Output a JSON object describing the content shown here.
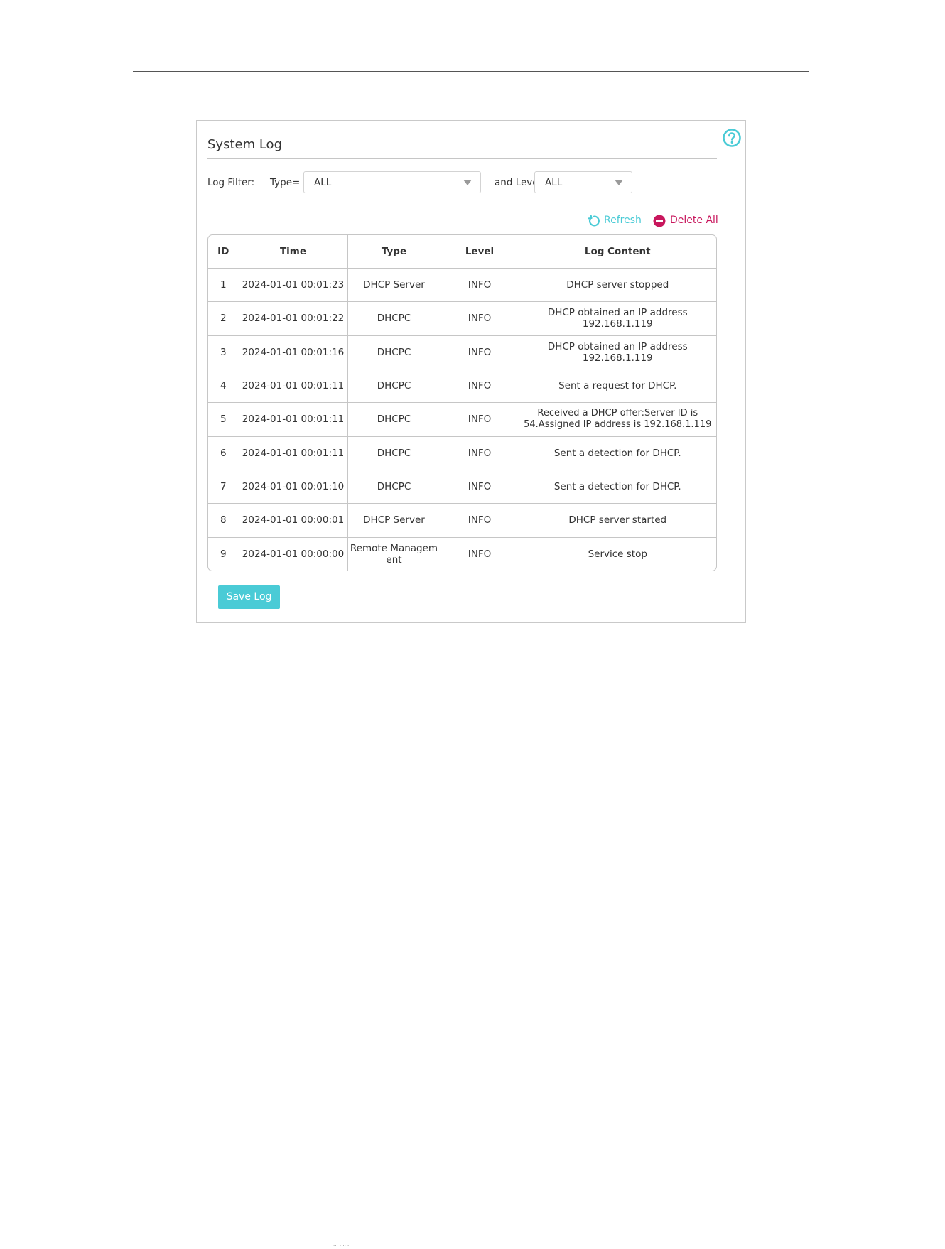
{
  "panel": {
    "title": "System Log"
  },
  "filter": {
    "label": "Log Filter:",
    "type_label": "Type=",
    "type_value": "ALL",
    "level_label": "and Level=",
    "level_value": "ALL"
  },
  "actions": {
    "refresh_label": "Refresh",
    "delete_all_label": "Delete All"
  },
  "colors": {
    "accent": "#4acbd6",
    "danger": "#c8175d"
  },
  "table": {
    "headers": [
      "ID",
      "Time",
      "Type",
      "Level",
      "Log Content"
    ],
    "rows": [
      [
        "1",
        "2024-01-01 00:01:23",
        "DHCP Server",
        "INFO",
        "DHCP server stopped"
      ],
      [
        "2",
        "2024-01-01 00:01:22",
        "DHCPC",
        "INFO",
        "DHCP obtained an IP address 192.168.1.119"
      ],
      [
        "3",
        "2024-01-01 00:01:16",
        "DHCPC",
        "INFO",
        "DHCP obtained an IP address 192.168.1.119"
      ],
      [
        "4",
        "2024-01-01 00:01:11",
        "DHCPC",
        "INFO",
        "Sent a request for DHCP."
      ],
      [
        "5",
        "2024-01-01 00:01:11",
        "DHCPC",
        "INFO",
        "Received a DHCP offer:Server ID is 54.Assigned IP address is 192.168.1.119"
      ],
      [
        "6",
        "2024-01-01 00:01:11",
        "DHCPC",
        "INFO",
        "Sent a detection for DHCP."
      ],
      [
        "7",
        "2024-01-01 00:01:10",
        "DHCPC",
        "INFO",
        "Sent a detection for DHCP."
      ],
      [
        "8",
        "2024-01-01 00:00:01",
        "DHCP Server",
        "INFO",
        "DHCP server started"
      ],
      [
        "9",
        "2024-01-01 00:00:00",
        "Remote Management",
        "INFO",
        "Service stop"
      ]
    ]
  },
  "buttons": {
    "save_log": "Save Log"
  },
  "footer": {
    "text": "··· · ·· ··"
  }
}
